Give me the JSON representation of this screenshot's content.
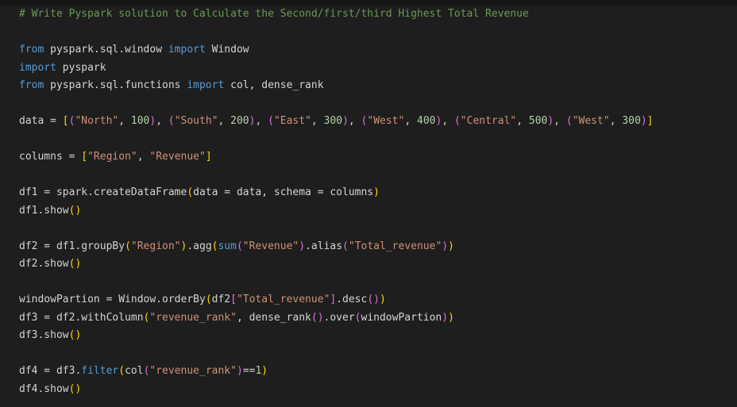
{
  "editor": {
    "lines": [
      [
        {
          "t": "# Write Pyspark solution to Calculate the Second/first/third Highest Total Revenue",
          "k": "comment"
        }
      ],
      [],
      [
        {
          "t": "from",
          "k": "keyword"
        },
        {
          "t": " pyspark.sql.window ",
          "k": "default"
        },
        {
          "t": "import",
          "k": "keyword"
        },
        {
          "t": " Window",
          "k": "default"
        }
      ],
      [
        {
          "t": "import",
          "k": "keyword"
        },
        {
          "t": " pyspark",
          "k": "default"
        }
      ],
      [
        {
          "t": "from",
          "k": "keyword"
        },
        {
          "t": " pyspark.sql.functions ",
          "k": "default"
        },
        {
          "t": "import",
          "k": "keyword"
        },
        {
          "t": " col, dense_rank",
          "k": "default"
        }
      ],
      [],
      [
        {
          "t": "data = ",
          "k": "default"
        },
        {
          "t": "[",
          "k": "bracket-gold"
        },
        {
          "t": "(",
          "k": "bracket-purple"
        },
        {
          "t": "\"North\"",
          "k": "string"
        },
        {
          "t": ", ",
          "k": "default"
        },
        {
          "t": "100",
          "k": "number"
        },
        {
          "t": ")",
          "k": "bracket-purple"
        },
        {
          "t": ", ",
          "k": "default"
        },
        {
          "t": "(",
          "k": "bracket-purple"
        },
        {
          "t": "\"South\"",
          "k": "string"
        },
        {
          "t": ", ",
          "k": "default"
        },
        {
          "t": "200",
          "k": "number"
        },
        {
          "t": ")",
          "k": "bracket-purple"
        },
        {
          "t": ", ",
          "k": "default"
        },
        {
          "t": "(",
          "k": "bracket-purple"
        },
        {
          "t": "\"East\"",
          "k": "string"
        },
        {
          "t": ", ",
          "k": "default"
        },
        {
          "t": "300",
          "k": "number"
        },
        {
          "t": ")",
          "k": "bracket-purple"
        },
        {
          "t": ", ",
          "k": "default"
        },
        {
          "t": "(",
          "k": "bracket-purple"
        },
        {
          "t": "\"West\"",
          "k": "string"
        },
        {
          "t": ", ",
          "k": "default"
        },
        {
          "t": "400",
          "k": "number"
        },
        {
          "t": ")",
          "k": "bracket-purple"
        },
        {
          "t": ", ",
          "k": "default"
        },
        {
          "t": "(",
          "k": "bracket-purple"
        },
        {
          "t": "\"Central\"",
          "k": "string"
        },
        {
          "t": ", ",
          "k": "default"
        },
        {
          "t": "500",
          "k": "number"
        },
        {
          "t": ")",
          "k": "bracket-purple"
        },
        {
          "t": ", ",
          "k": "default"
        },
        {
          "t": "(",
          "k": "bracket-purple"
        },
        {
          "t": "\"West\"",
          "k": "string"
        },
        {
          "t": ", ",
          "k": "default"
        },
        {
          "t": "300",
          "k": "number"
        },
        {
          "t": ")",
          "k": "bracket-purple"
        },
        {
          "t": "]",
          "k": "bracket-gold"
        }
      ],
      [],
      [
        {
          "t": "columns = ",
          "k": "default"
        },
        {
          "t": "[",
          "k": "bracket-gold"
        },
        {
          "t": "\"Region\"",
          "k": "string"
        },
        {
          "t": ", ",
          "k": "default"
        },
        {
          "t": "\"Revenue\"",
          "k": "string"
        },
        {
          "t": "]",
          "k": "bracket-gold"
        }
      ],
      [],
      [
        {
          "t": "df1 = spark.createDataFrame",
          "k": "default"
        },
        {
          "t": "(",
          "k": "bracket-gold"
        },
        {
          "t": "data = data, schema = columns",
          "k": "default"
        },
        {
          "t": ")",
          "k": "bracket-gold"
        }
      ],
      [
        {
          "t": "df1.show",
          "k": "default"
        },
        {
          "t": "()",
          "k": "bracket-gold"
        }
      ],
      [],
      [
        {
          "t": "df2 = df1.groupBy",
          "k": "default"
        },
        {
          "t": "(",
          "k": "bracket-gold"
        },
        {
          "t": "\"Region\"",
          "k": "string"
        },
        {
          "t": ")",
          "k": "bracket-gold"
        },
        {
          "t": ".agg",
          "k": "default"
        },
        {
          "t": "(",
          "k": "bracket-gold"
        },
        {
          "t": "sum",
          "k": "builtin"
        },
        {
          "t": "(",
          "k": "bracket-purple"
        },
        {
          "t": "\"Revenue\"",
          "k": "string"
        },
        {
          "t": ")",
          "k": "bracket-purple"
        },
        {
          "t": ".alias",
          "k": "default"
        },
        {
          "t": "(",
          "k": "bracket-purple"
        },
        {
          "t": "\"Total_revenue\"",
          "k": "string"
        },
        {
          "t": ")",
          "k": "bracket-purple"
        },
        {
          "t": ")",
          "k": "bracket-gold"
        }
      ],
      [
        {
          "t": "df2.show",
          "k": "default"
        },
        {
          "t": "()",
          "k": "bracket-gold"
        }
      ],
      [],
      [
        {
          "t": "windowPartion = Window.orderBy",
          "k": "default"
        },
        {
          "t": "(",
          "k": "bracket-gold"
        },
        {
          "t": "df2",
          "k": "default"
        },
        {
          "t": "[",
          "k": "bracket-purple"
        },
        {
          "t": "\"Total_revenue\"",
          "k": "string"
        },
        {
          "t": "]",
          "k": "bracket-purple"
        },
        {
          "t": ".desc",
          "k": "default"
        },
        {
          "t": "()",
          "k": "bracket-purple"
        },
        {
          "t": ")",
          "k": "bracket-gold"
        }
      ],
      [
        {
          "t": "df3 = df2.withColumn",
          "k": "default"
        },
        {
          "t": "(",
          "k": "bracket-gold"
        },
        {
          "t": "\"revenue_rank\"",
          "k": "string"
        },
        {
          "t": ", dense_rank",
          "k": "default"
        },
        {
          "t": "()",
          "k": "bracket-purple"
        },
        {
          "t": ".over",
          "k": "default"
        },
        {
          "t": "(",
          "k": "bracket-purple"
        },
        {
          "t": "windowPartion",
          "k": "default"
        },
        {
          "t": ")",
          "k": "bracket-purple"
        },
        {
          "t": ")",
          "k": "bracket-gold"
        }
      ],
      [
        {
          "t": "df3.show",
          "k": "default"
        },
        {
          "t": "()",
          "k": "bracket-gold"
        }
      ],
      [],
      [
        {
          "t": "df4 = df3.",
          "k": "default"
        },
        {
          "t": "filter",
          "k": "builtin"
        },
        {
          "t": "(",
          "k": "bracket-gold"
        },
        {
          "t": "col",
          "k": "default"
        },
        {
          "t": "(",
          "k": "bracket-purple"
        },
        {
          "t": "\"revenue_rank\"",
          "k": "string"
        },
        {
          "t": ")",
          "k": "bracket-purple"
        },
        {
          "t": "==",
          "k": "default"
        },
        {
          "t": "1",
          "k": "number"
        },
        {
          "t": ")",
          "k": "bracket-gold"
        }
      ],
      [
        {
          "t": "df4.show",
          "k": "default"
        },
        {
          "t": "()",
          "k": "bracket-gold"
        }
      ]
    ]
  }
}
